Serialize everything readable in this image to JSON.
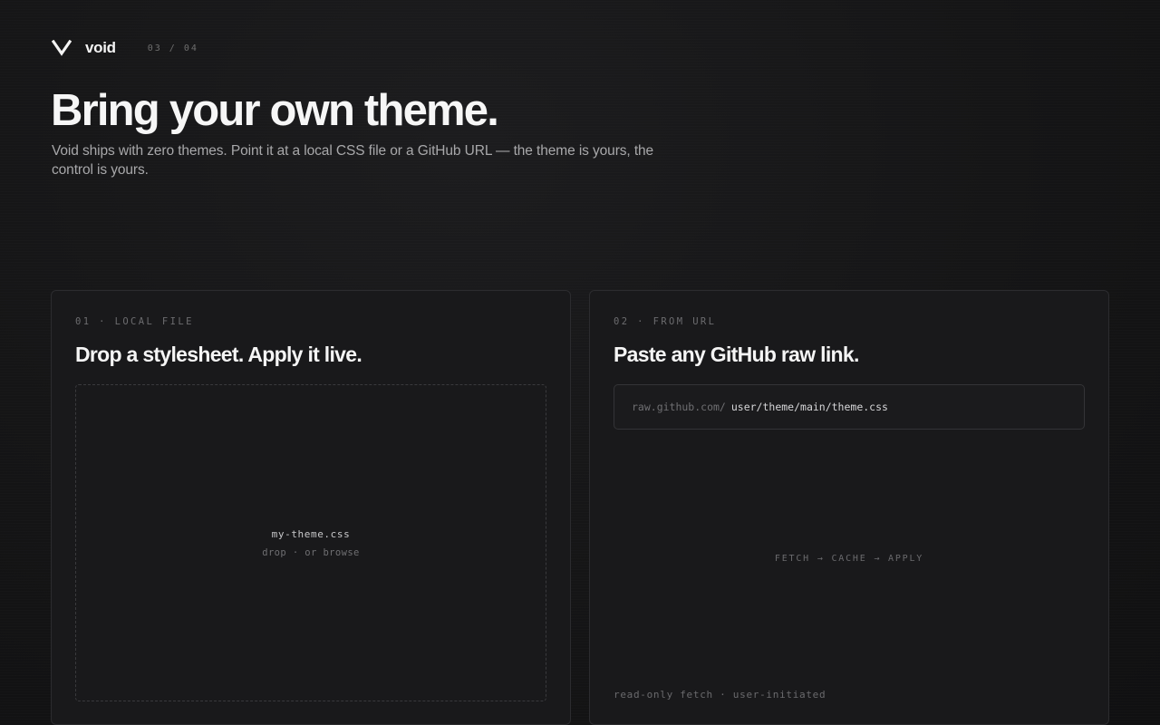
{
  "brand": {
    "name": "void",
    "logo_icon": "v-chevron-icon",
    "page_counter": "03 / 04"
  },
  "hero": {
    "title": "Bring your own theme.",
    "description": "Void ships with zero themes. Point it at a local CSS file or a GitHub URL — the theme is yours, the control is yours."
  },
  "cards": {
    "local": {
      "eyebrow": "01 · LOCAL FILE",
      "title": "Drop a stylesheet. Apply it live.",
      "filename": "my-theme.css",
      "hint_drop": "drop · or ",
      "hint_browse": "browse"
    },
    "url": {
      "eyebrow": "02 · FROM URL",
      "title": "Paste any GitHub raw link.",
      "url_prefix": "raw.github.com/",
      "url_path": "user/theme/main/theme.css",
      "pipeline": "FETCH → CACHE → APPLY",
      "footnote": "read-only fetch · user-initiated"
    }
  },
  "colors": {
    "background": "#141415",
    "card_background": "#19191b",
    "card_border": "#2c2c2f",
    "text_primary": "#f5f5f5",
    "text_muted": "#6c6c6f"
  }
}
